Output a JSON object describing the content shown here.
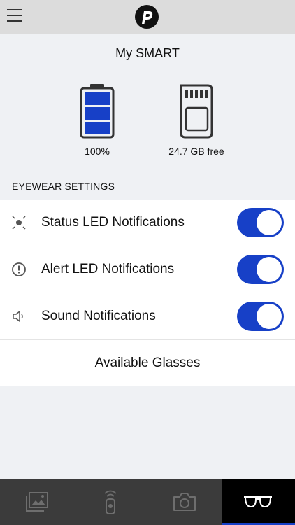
{
  "header": {
    "menu_icon": "hamburger-menu-icon",
    "logo_icon": "p-logo-icon"
  },
  "device": {
    "title": "My SMART",
    "battery_label": "100%",
    "battery_level": 1.0,
    "storage_label": "24.7 GB free"
  },
  "settings": {
    "section_title": "EYEWEAR SETTINGS",
    "items": [
      {
        "label": "Status LED Notifications",
        "icon": "status-led-icon",
        "enabled": true
      },
      {
        "label": "Alert LED Notifications",
        "icon": "alert-icon",
        "enabled": true
      },
      {
        "label": "Sound Notifications",
        "icon": "speaker-icon",
        "enabled": true
      }
    ],
    "available_glasses": "Available Glasses"
  },
  "tabbar": {
    "tabs": [
      {
        "icon": "gallery-icon",
        "active": false
      },
      {
        "icon": "remote-control-icon",
        "active": false
      },
      {
        "icon": "camera-icon",
        "active": false
      },
      {
        "icon": "glasses-icon",
        "active": true
      }
    ]
  },
  "colors": {
    "accent": "#1740c7",
    "topbar": "#dcdcdc",
    "background": "#eff1f4",
    "tabbar": "#3b3b3b"
  }
}
